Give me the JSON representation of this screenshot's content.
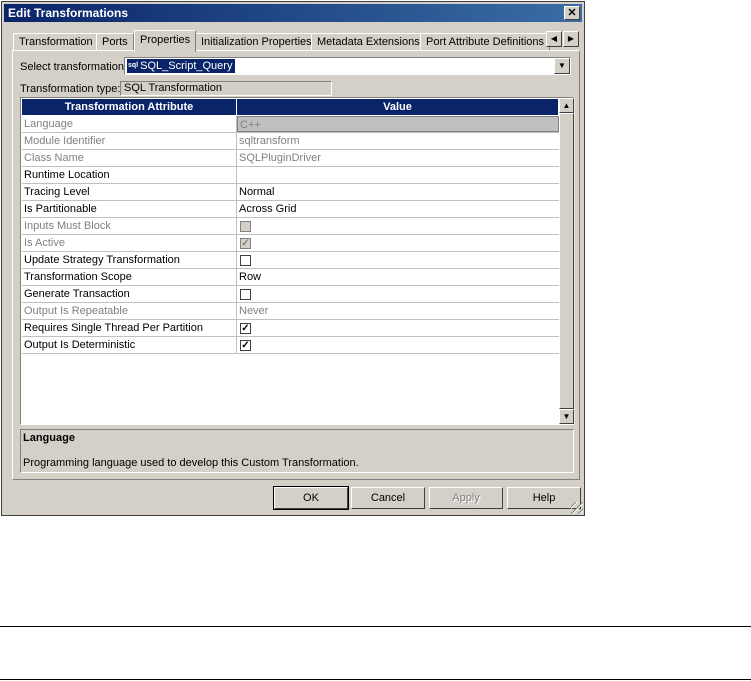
{
  "window": {
    "title": "Edit Transformations",
    "close_glyph": "✕"
  },
  "tabs": [
    {
      "label": "Transformation"
    },
    {
      "label": "Ports"
    },
    {
      "label": "Properties"
    },
    {
      "label": "Initialization Properties"
    },
    {
      "label": "Metadata Extensions"
    },
    {
      "label": "Port Attribute Definitions"
    }
  ],
  "active_tab": "Properties",
  "select_transformation": {
    "label": "Select transformation:",
    "value": "SQL_Script_Query",
    "icon_text": "sql"
  },
  "transformation_type": {
    "label": "Transformation type:",
    "value": "SQL Transformation"
  },
  "grid": {
    "headers": [
      "Transformation Attribute",
      "Value"
    ],
    "rows": [
      {
        "attribute": "Language",
        "value": "C++"
      },
      {
        "attribute": "Module Identifier",
        "value": "sqltransform"
      },
      {
        "attribute": "Class Name",
        "value": "SQLPluginDriver"
      },
      {
        "attribute": "Runtime Location",
        "value": ""
      },
      {
        "attribute": "Tracing Level",
        "value": "Normal"
      },
      {
        "attribute": "Is Partitionable",
        "value": "Across Grid"
      },
      {
        "attribute": "Inputs Must Block",
        "value": ""
      },
      {
        "attribute": "Is Active",
        "value": ""
      },
      {
        "attribute": "Update Strategy Transformation",
        "value": ""
      },
      {
        "attribute": "Transformation Scope",
        "value": "Row"
      },
      {
        "attribute": "Generate Transaction",
        "value": ""
      },
      {
        "attribute": "Output Is Repeatable",
        "value": "Never"
      },
      {
        "attribute": "Requires Single Thread Per Partition",
        "value": ""
      },
      {
        "attribute": "Output Is Deterministic",
        "value": ""
      }
    ]
  },
  "description": {
    "title": "Language",
    "text": "Programming language used to develop this Custom Transformation."
  },
  "buttons": {
    "ok": "OK",
    "cancel": "Cancel",
    "apply": "Apply",
    "help": "Help"
  },
  "check_glyph": "✓"
}
